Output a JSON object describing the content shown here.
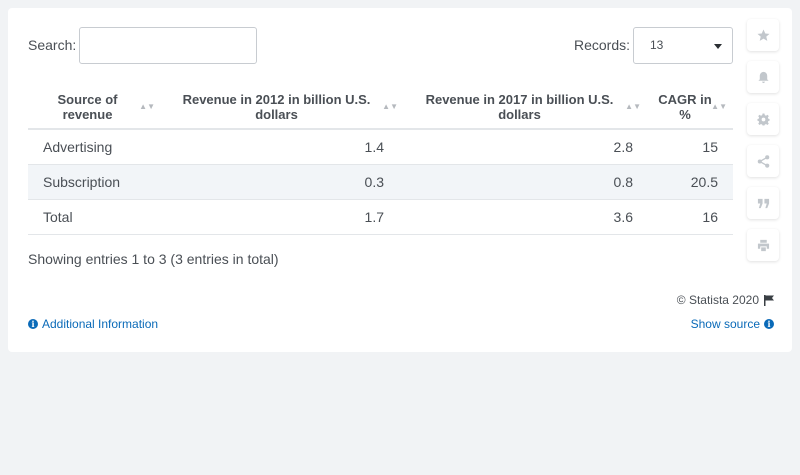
{
  "search": {
    "label": "Search:",
    "value": "",
    "placeholder": ""
  },
  "records": {
    "label": "Records:",
    "value": "13"
  },
  "table": {
    "headers": [
      "Source of revenue",
      "Revenue in 2012 in billion U.S. dollars",
      "Revenue in 2017 in billion U.S. dollars",
      "CAGR in %"
    ],
    "rows": [
      [
        "Advertising",
        "1.4",
        "2.8",
        "15"
      ],
      [
        "Subscription",
        "0.3",
        "0.8",
        "20.5"
      ],
      [
        "Total",
        "1.7",
        "3.6",
        "16"
      ]
    ]
  },
  "footer": {
    "showing": "Showing entries 1 to 3 (3 entries in total)",
    "copyright": "© Statista 2020",
    "additional_info": "Additional Information",
    "show_source": "Show source"
  },
  "sidebar": [
    "star-icon",
    "bell-icon",
    "gear-icon",
    "share-icon",
    "quote-icon",
    "print-icon"
  ],
  "colors": {
    "link": "#0a6ab8",
    "stripe": "#f2f5f8",
    "icon": "#c2c7cc"
  }
}
